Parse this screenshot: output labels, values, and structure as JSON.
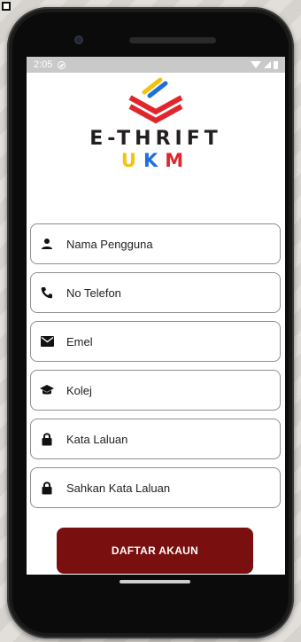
{
  "status_bar": {
    "time": "2:05",
    "dnd_icon": "do-not-disturb-icon",
    "wifi_icon": "wifi-icon",
    "signal_icon": "signal-icon",
    "battery_icon": "battery-icon"
  },
  "brand": {
    "line1": "E-THRIFT",
    "line2": [
      "U",
      "K",
      "M"
    ],
    "colors": {
      "u": "#f4c20d",
      "k": "#1e6fd9",
      "m": "#e0262d",
      "logo_red": "#e0262d"
    }
  },
  "form": {
    "fields": [
      {
        "placeholder": "Nama Pengguna",
        "icon": "person-icon"
      },
      {
        "placeholder": "No Telefon",
        "icon": "phone-icon"
      },
      {
        "placeholder": "Emel",
        "icon": "email-icon"
      },
      {
        "placeholder": "Kolej",
        "icon": "school-icon"
      },
      {
        "placeholder": "Kata Laluan",
        "icon": "lock-icon"
      },
      {
        "placeholder": "Sahkan Kata Laluan",
        "icon": "lock-icon"
      }
    ]
  },
  "submit": {
    "label": "DAFTAR AKAUN",
    "color": "#7a0f0f"
  }
}
